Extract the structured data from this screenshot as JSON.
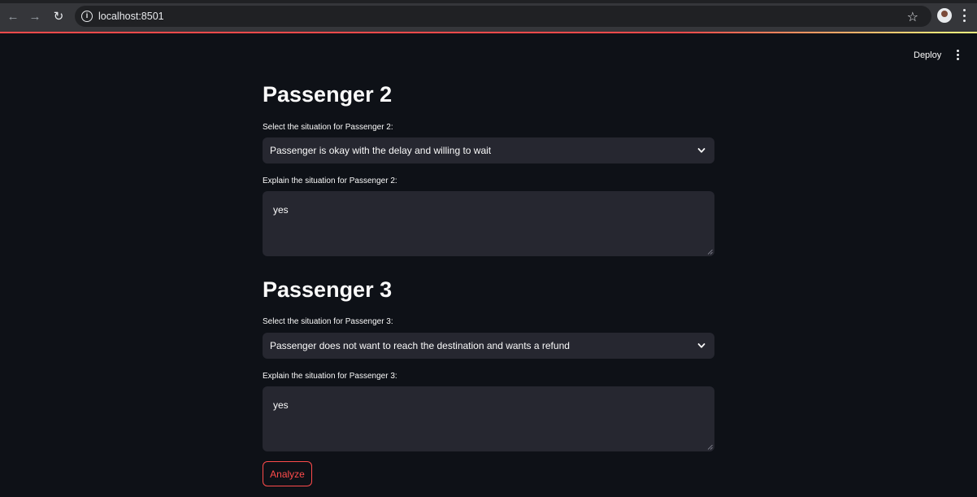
{
  "browser": {
    "url": "localhost:8501",
    "nav_back": "←",
    "nav_forward": "→",
    "reload": "↻",
    "info": "i",
    "bookmark": "☆"
  },
  "header": {
    "deploy_label": "Deploy"
  },
  "passengers": [
    {
      "title": "Passenger 2",
      "select_label": "Select the situation for Passenger 2:",
      "select_value": "Passenger is okay with the delay and willing to wait",
      "explain_label": "Explain the situation for Passenger 2:",
      "explain_value": "yes"
    },
    {
      "title": "Passenger 3",
      "select_label": "Select the situation for Passenger 3:",
      "select_value": "Passenger does not want to reach the destination and wants a refund",
      "explain_label": "Explain the situation for Passenger 3:",
      "explain_value": "yes"
    }
  ],
  "actions": {
    "analyze_label": "Analyze"
  },
  "colors": {
    "background": "#0e1117",
    "input_bg": "#262730",
    "accent": "#ff4b4b"
  }
}
